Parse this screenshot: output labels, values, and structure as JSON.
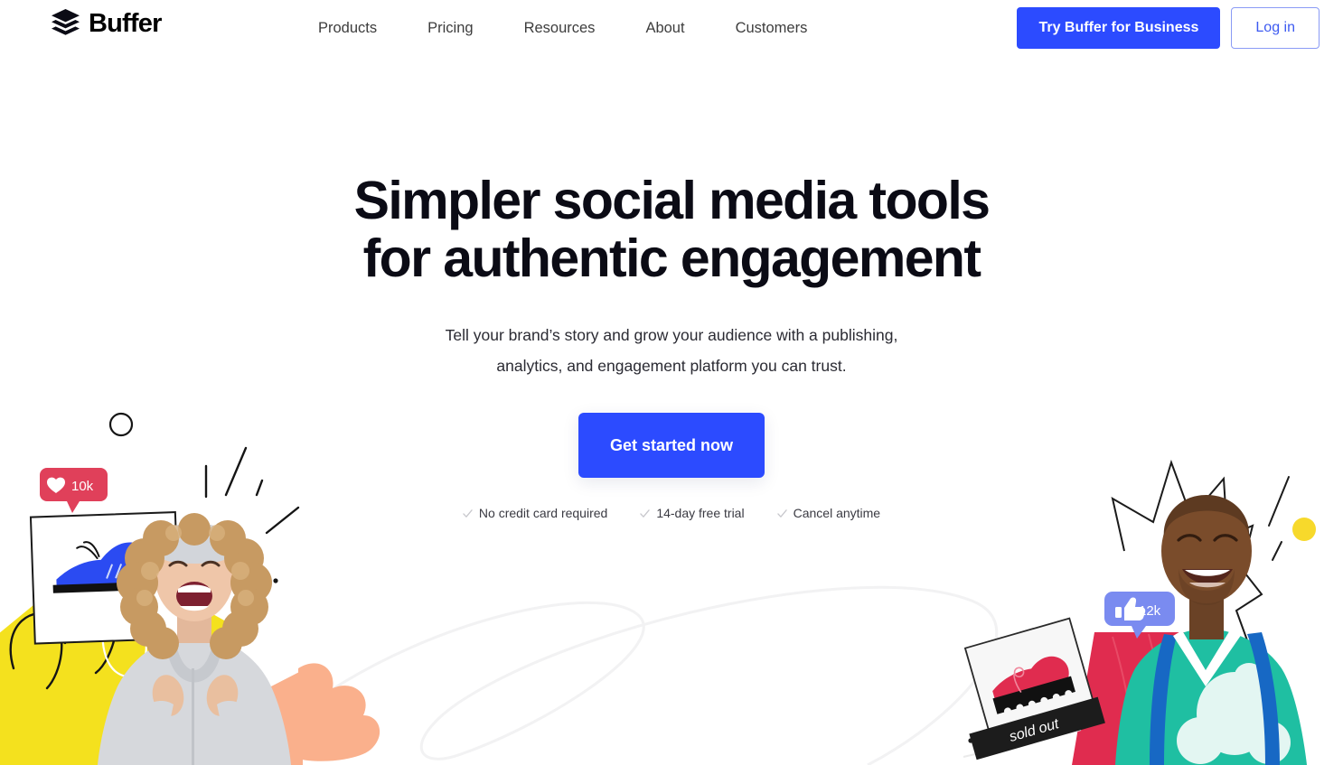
{
  "brand": {
    "name": "Buffer",
    "logo_icon": "buffer-stacked-layers-icon",
    "primary_color": "#2c4bff"
  },
  "header": {
    "nav": [
      {
        "label": "Products"
      },
      {
        "label": "Pricing"
      },
      {
        "label": "Resources"
      },
      {
        "label": "About"
      },
      {
        "label": "Customers"
      }
    ],
    "cta_primary": "Try Buffer for Business",
    "cta_secondary": "Log in"
  },
  "hero": {
    "headline_line1": "Simpler social media tools",
    "headline_line2": "for authentic engagement",
    "subhead_line1": "Tell your brand’s story and grow your audience with a",
    "subhead_line2": "publishing, analytics, and engagement platform you can trust.",
    "cta_label": "Get started now",
    "trust_items": [
      {
        "label": "No credit card required",
        "icon": "check-icon"
      },
      {
        "label": "14-day free trial",
        "icon": "check-icon"
      },
      {
        "label": "Cancel anytime",
        "icon": "check-icon"
      }
    ]
  },
  "illustration_left": {
    "description": "Laughing woman with curly blonde hair wearing a grey hoodie",
    "like_badge": {
      "icon": "heart-icon",
      "count": "10k",
      "color": "#e0405a"
    },
    "photo_card": {
      "icon": "blue-sneaker-icon"
    },
    "shapes": [
      {
        "name": "yellow-shopping-bag-shape",
        "color": "#f4e11e"
      },
      {
        "name": "peach-blob-shape",
        "color": "#fab08c"
      },
      {
        "name": "outline-circle-doodle",
        "color": "#1a1a1a"
      }
    ]
  },
  "illustration_right": {
    "description": "Smiling man in teal and white jersey",
    "like_badge": {
      "icon": "thumbs-up-icon",
      "count": "12k",
      "color": "#7a8bf0"
    },
    "photo_card": {
      "icon": "red-cleat-icon",
      "banner_label": "sold out"
    },
    "shapes": [
      {
        "name": "crimson-shape",
        "color": "#e02c4f"
      },
      {
        "name": "yellow-dot-shape",
        "color": "#f7d92b"
      },
      {
        "name": "starburst-doodle",
        "color": "#1a1a1a"
      }
    ]
  }
}
